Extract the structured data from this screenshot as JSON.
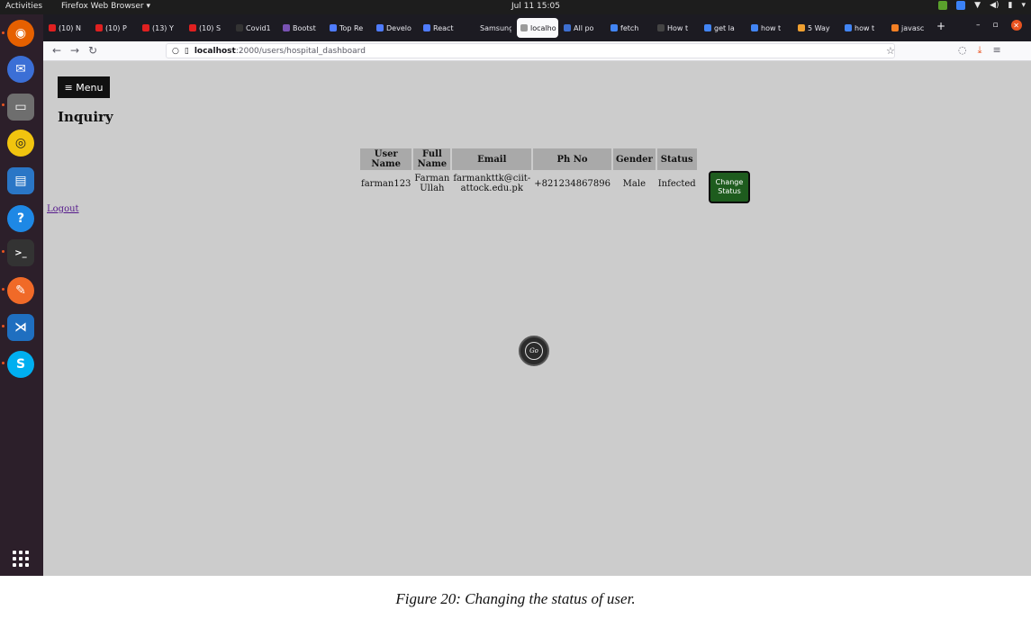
{
  "topbar": {
    "activities": "Activities",
    "app_menu": "Firefox Web Browser ▾",
    "clock": "Jul 11  15:05"
  },
  "browser": {
    "tabs": [
      {
        "label": "(10) N",
        "fav_color": "#e02020"
      },
      {
        "label": "(10) P",
        "fav_color": "#e02020"
      },
      {
        "label": "(13) Y",
        "fav_color": "#e02020"
      },
      {
        "label": "(10) S",
        "fav_color": "#e02020"
      },
      {
        "label": "Covid1",
        "fav_color": "#333333"
      },
      {
        "label": "Bootst",
        "fav_color": "#7952b3"
      },
      {
        "label": "Top Re",
        "fav_color": "#4f7cff"
      },
      {
        "label": "Develo",
        "fav_color": "#4f7cff"
      },
      {
        "label": "React",
        "fav_color": "#4f7cff"
      },
      {
        "label": "Samsung",
        "fav_color": "#1c1b22"
      },
      {
        "label": "localho",
        "fav_color": "#9a9a9a",
        "active": true
      },
      {
        "label": "All po",
        "fav_color": "#3d6fd1"
      },
      {
        "label": "fetch",
        "fav_color": "#4285f4"
      },
      {
        "label": "How t",
        "fav_color": "#444444"
      },
      {
        "label": "get la",
        "fav_color": "#4285f4"
      },
      {
        "label": "how t",
        "fav_color": "#4285f4"
      },
      {
        "label": "5 Way",
        "fav_color": "#f0a030"
      },
      {
        "label": "how t",
        "fav_color": "#4285f4"
      },
      {
        "label": "javasc",
        "fav_color": "#f48024"
      }
    ],
    "new_tab": "+",
    "url_host": "localhost",
    "url_path": ":2000/users/hospital_dashboard"
  },
  "page": {
    "menu_label": "≡ Menu",
    "title": "Inquiry",
    "logout_label": "Logout",
    "table": {
      "headers": [
        "User Name",
        "Full Name",
        "Email",
        "Ph No",
        "Gender",
        "Status"
      ],
      "rows": [
        [
          "farman123",
          "Farman Ullah",
          "farmankttk@ciit-attock.edu.pk",
          "+821234867896",
          "Male",
          "Infected"
        ]
      ]
    },
    "change_status_label": "Change Status",
    "go_label": "Go"
  },
  "caption": "Figure 20: Changing the status of user."
}
